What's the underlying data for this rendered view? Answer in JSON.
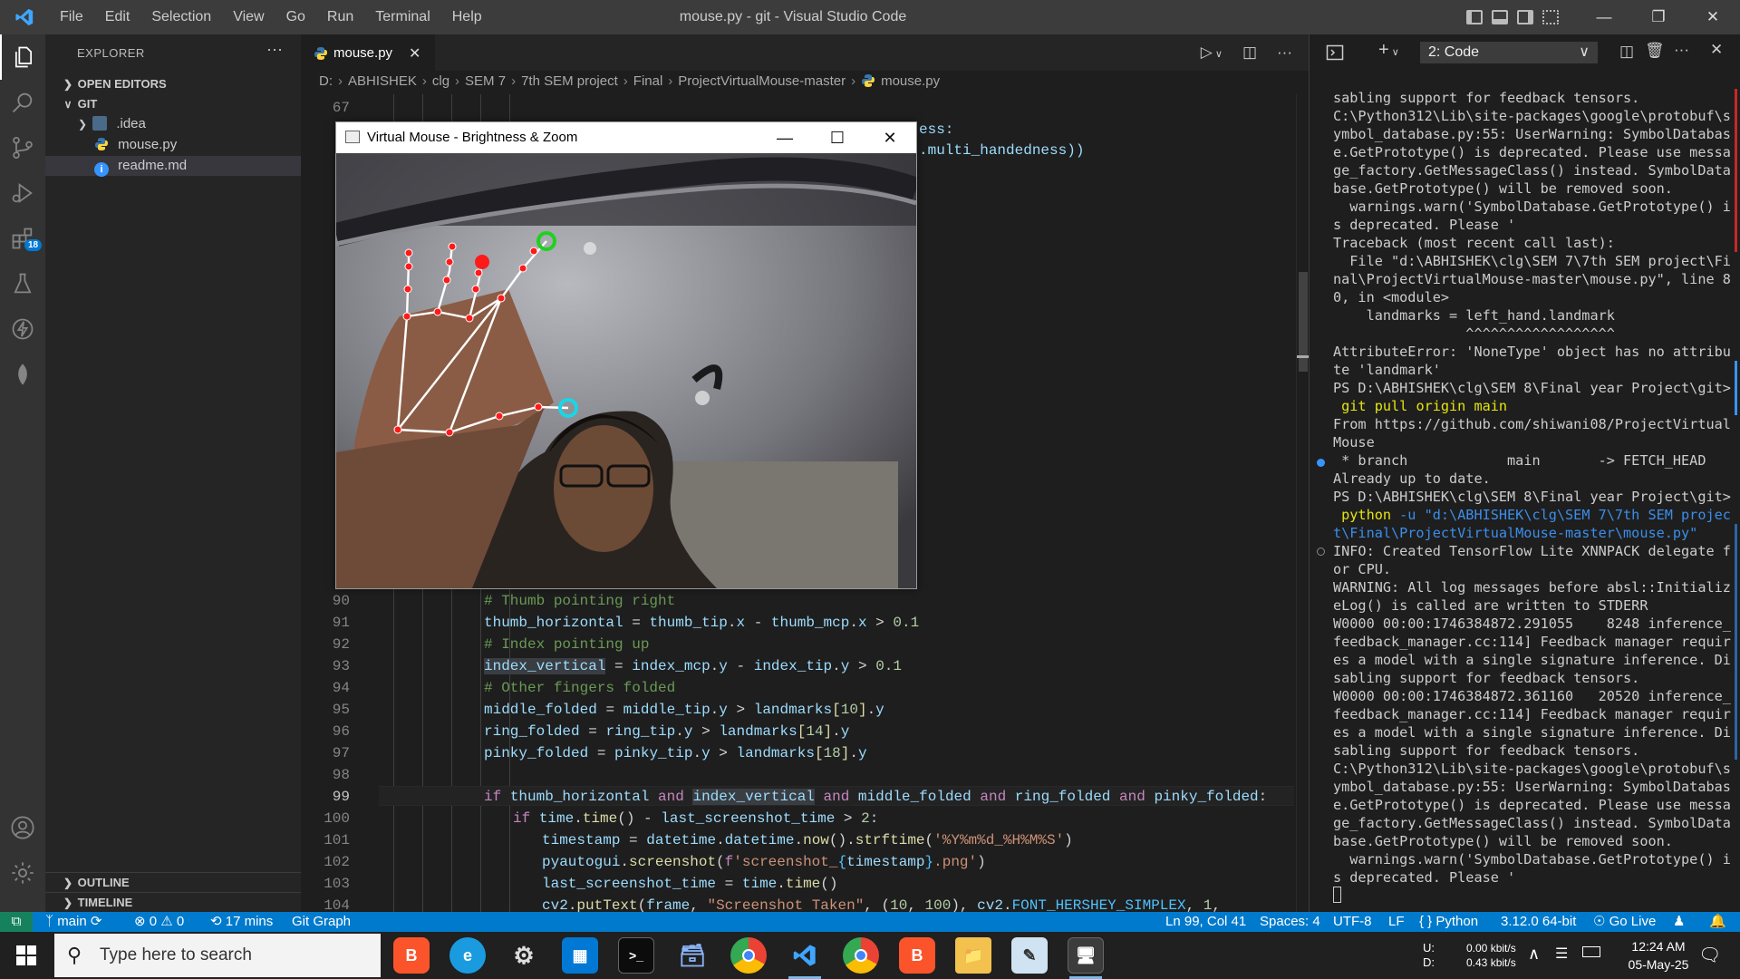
{
  "titlebar": {
    "menu": [
      "File",
      "Edit",
      "Selection",
      "View",
      "Go",
      "Run",
      "Terminal",
      "Help"
    ],
    "title": "mouse.py - git - Visual Studio Code"
  },
  "activity": {
    "extensions_badge": "18"
  },
  "sidebar": {
    "title": "EXPLORER",
    "open_editors": "OPEN EDITORS",
    "root": "GIT",
    "items": [
      {
        "label": ".idea",
        "kind": "folder"
      },
      {
        "label": "mouse.py",
        "kind": "python"
      },
      {
        "label": "readme.md",
        "kind": "info"
      }
    ],
    "outline": "OUTLINE",
    "timeline": "TIMELINE"
  },
  "tab": {
    "label": "mouse.py"
  },
  "breadcrumbs": [
    "D:",
    "ABHISHEK",
    "clg",
    "SEM 7",
    "7th SEM project",
    "Final",
    "ProjectVirtualMouse-master",
    "mouse.py"
  ],
  "editor": {
    "top_line": "67",
    "peek_text_1": "ess:",
    "peek_text_2": ".multi_handedness))",
    "lines": [
      {
        "n": "90",
        "t": "# Thumb pointing right"
      },
      {
        "n": "91",
        "t": "thumb_horizontal = thumb_tip.x - thumb_mcp.x > 0.1"
      },
      {
        "n": "92",
        "t": "# Index pointing up"
      },
      {
        "n": "93",
        "t": "index_vertical = index_mcp.y - index_tip.y > 0.1"
      },
      {
        "n": "94",
        "t": "# Other fingers folded"
      },
      {
        "n": "95",
        "t": "middle_folded = middle_tip.y > landmarks[10].y"
      },
      {
        "n": "96",
        "t": "ring_folded = ring_tip.y > landmarks[14].y"
      },
      {
        "n": "97",
        "t": "pinky_folded = pinky_tip.y > landmarks[18].y"
      },
      {
        "n": "98",
        "t": ""
      },
      {
        "n": "99",
        "t": "if thumb_horizontal and index_vertical and middle_folded and ring_folded and pinky_folded:"
      },
      {
        "n": "100",
        "t": "if time.time() - last_screenshot_time > 2:"
      },
      {
        "n": "101",
        "t": "timestamp = datetime.datetime.now().strftime('%Y%m%d_%H%M%S')"
      },
      {
        "n": "102",
        "t": "pyautogui.screenshot(f'screenshot_{timestamp}.png')"
      },
      {
        "n": "103",
        "t": "last_screenshot_time = time.time()"
      },
      {
        "n": "104",
        "t": "cv2.putText(frame, \"Screenshot Taken\", (10, 100), cv2.FONT_HERSHEY_SIMPLEX, 1,"
      }
    ]
  },
  "popup": {
    "title": "Virtual Mouse - Brightness & Zoom"
  },
  "panel": {
    "terminal_select": "2: Code"
  },
  "terminal": [
    "sabling support for feedback tensors.",
    "C:\\Python312\\Lib\\site-packages\\google\\protobuf\\s",
    "ymbol_database.py:55: UserWarning: SymbolDatabas",
    "e.GetPrototype() is deprecated. Please use messa",
    "ge_factory.GetMessageClass() instead. SymbolData",
    "base.GetPrototype() will be removed soon.",
    "  warnings.warn('SymbolDatabase.GetPrototype() i",
    "s deprecated. Please '",
    "Traceback (most recent call last):",
    "  File \"d:\\ABHISHEK\\clg\\SEM 7\\7th SEM project\\Fi",
    "nal\\ProjectVirtualMouse-master\\mouse.py\", line 8",
    "0, in <module>",
    "    landmarks = left_hand.landmark",
    "                ^^^^^^^^^^^^^^^^^^",
    "AttributeError: 'NoneType' object has no attribu",
    "te 'landmark'",
    "PS D:\\ABHISHEK\\clg\\SEM 8\\Final year Project\\git>",
    " git pull origin main",
    "From https://github.com/shiwani08/ProjectVirtual",
    "Mouse",
    " * branch            main       -> FETCH_HEAD",
    "Already up to date.",
    "PS D:\\ABHISHEK\\clg\\SEM 8\\Final year Project\\git>",
    " python -u \"d:\\ABHISHEK\\clg\\SEM 7\\7th SEM projec",
    "t\\Final\\ProjectVirtualMouse-master\\mouse.py\"",
    "INFO: Created TensorFlow Lite XNNPACK delegate f",
    "or CPU.",
    "WARNING: All log messages before absl::Initializ",
    "eLog() is called are written to STDERR",
    "W0000 00:00:1746384872.291055    8248 inference_",
    "feedback_manager.cc:114] Feedback manager requir",
    "es a model with a single signature inference. Di",
    "sabling support for feedback tensors.",
    "W0000 00:00:1746384872.361160   20520 inference_",
    "feedback_manager.cc:114] Feedback manager requir",
    "es a model with a single signature inference. Di",
    "sabling support for feedback tensors.",
    "C:\\Python312\\Lib\\site-packages\\google\\protobuf\\s",
    "ymbol_database.py:55: UserWarning: SymbolDatabas",
    "e.GetPrototype() is deprecated. Please use messa",
    "ge_factory.GetMessageClass() instead. SymbolData",
    "base.GetPrototype() will be removed soon.",
    "  warnings.warn('SymbolDatabase.GetPrototype() i",
    "s deprecated. Please '",
    ""
  ],
  "status": {
    "branch": "main",
    "errors": "0",
    "warnings": "0",
    "time": "17 mins",
    "git_graph": "Git Graph",
    "position": "Ln 99, Col 41",
    "spaces": "Spaces: 4",
    "encoding": "UTF-8",
    "eol": "LF",
    "language": "Python",
    "interpreter": "3.12.0 64-bit",
    "golive": "Go Live"
  },
  "taskbar": {
    "search_placeholder": "Type here to search",
    "net_up_label": "U:",
    "net_down_label": "D:",
    "net_up": "0.00 kbit/s",
    "net_down": "0.43 kbit/s",
    "time": "12:24 AM",
    "date": "05-May-25"
  },
  "colors": {
    "accent": "#007acc",
    "activity_bg": "#333333",
    "sidebar_bg": "#252526",
    "editor_bg": "#1e1e1e"
  }
}
